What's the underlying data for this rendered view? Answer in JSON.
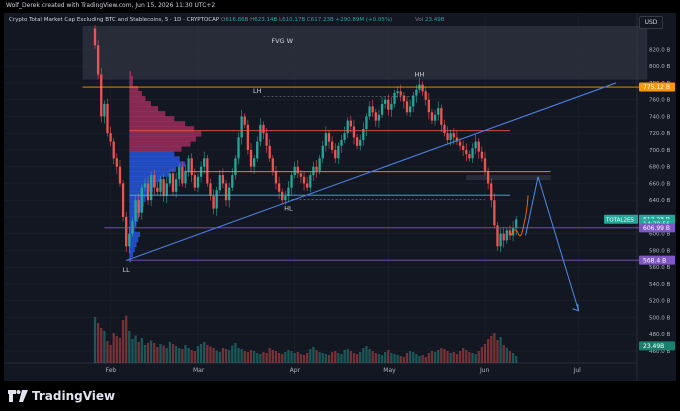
{
  "header": {
    "credit": "Wolf_Derek created with TradingView.com, Jun 15, 2026 11:30 UTC+2",
    "currency": "USD"
  },
  "legend": {
    "symbol": "Crypto Total Market Cap Excluding BTC and Stablecoins, 5 · 1D · CRYPTOCAP",
    "o_label": "O",
    "o": "616.86B",
    "h_label": "H",
    "h": "623.14B",
    "l_label": "L",
    "l": "610.17B",
    "c_label": "C",
    "c": "617.23B",
    "change": "+290.89M (+0.05%)",
    "vol_label": "Vol ",
    "vol": "23.49B"
  },
  "footer": {
    "brand": "TradingView"
  },
  "colors": {
    "up": "#26a69a",
    "down": "#ef5350",
    "background": "#131722",
    "grid": "#1e222d",
    "axis_text": "#b2b5be",
    "trendline": "#4c7dde",
    "orange": "#ff9800",
    "purple": "#7e57c2",
    "cyan": "#26c6da",
    "profile_blue": "#2962ff",
    "profile_pink": "#b8336a",
    "fvg_box": "#3a3e4a",
    "current_price": "#26a69a",
    "vol_label_bg": "#1b7f6e",
    "projection": "#4d8ce6",
    "curve": "#ff6d00"
  },
  "chart_data": {
    "type": "candlestick",
    "y_unit": "B",
    "ylim": [
      448,
      848
    ],
    "y_ticks": [
      460,
      480,
      500,
      520,
      540,
      560,
      580,
      600,
      620,
      640,
      660,
      680,
      700,
      720,
      740,
      760,
      780,
      800,
      820
    ],
    "x_ticks": [
      "Feb",
      "Mar",
      "Apr",
      "May",
      "Jun",
      "Jul"
    ],
    "price_labels": [
      {
        "text": "775.12 B",
        "value": 775.12,
        "color": "#ff9800"
      },
      {
        "text": "617.23 B",
        "value": 617.23,
        "color": "#26a69a",
        "prefix": "TOTAL2ES"
      },
      {
        "text": "14:29:56",
        "value": 612,
        "color": "#26a69a"
      },
      {
        "text": "606.99 B",
        "value": 606.99,
        "color": "#7e57c2"
      },
      {
        "text": "568.4 B",
        "value": 568.4,
        "color": "#7e57c2"
      },
      {
        "text": "23.49B",
        "value": 466,
        "color": "#1b7f6e"
      }
    ],
    "annotations": [
      {
        "text": "FVG W",
        "x": "Mar 28",
        "y": 828
      },
      {
        "text": "HH",
        "x": "May 11",
        "y": 788
      },
      {
        "text": "LH",
        "x": "Mar 20",
        "y": 768
      },
      {
        "text": "HL",
        "x": "Mar 30",
        "y": 628
      },
      {
        "text": "LL",
        "x": "Feb 06",
        "y": 554
      }
    ],
    "levels": [
      {
        "name": "orange-top",
        "value": 775.12,
        "from": "Jan 23",
        "to": "Jul 23",
        "color": "#ff9800"
      },
      {
        "name": "red-profile",
        "value": 723,
        "from": "Feb 07",
        "to": "Jun 09",
        "color": "#ef5350"
      },
      {
        "name": "orange-mid",
        "value": 674,
        "from": "Feb 25",
        "to": "Jun 22",
        "color": "#ff9800"
      },
      {
        "name": "cyan",
        "value": 646,
        "from": "Feb 07",
        "to": "Jun 09",
        "color": "#26c6da"
      },
      {
        "name": "purple-upper",
        "value": 606.99,
        "from": "Jan 30",
        "to": "Jul 23",
        "color": "#7e57c2"
      },
      {
        "name": "purple-lower",
        "value": 568.4,
        "from": "Feb 06",
        "to": "Jul 23",
        "color": "#7e57c2"
      }
    ],
    "dashed_levels": [
      {
        "value": 764,
        "from": "Mar 22",
        "to": "May 10"
      },
      {
        "value": 641,
        "from": "Mar 31",
        "to": "Jun 01"
      }
    ],
    "fvg_zones": [
      {
        "from": "Jan 23",
        "to": "Jul 23",
        "low": 784,
        "high": 848
      },
      {
        "from": "May 26",
        "to": "Jun 22",
        "low": 664,
        "high": 670
      }
    ],
    "trendline": {
      "from": [
        "Feb 06",
        568
      ],
      "to": [
        "Jul 13",
        780
      ]
    },
    "projection": [
      [
        "Jun 14",
        598
      ],
      [
        "Jun 18",
        668
      ],
      [
        "Jul 01",
        508
      ]
    ],
    "volume_profile": [
      [
        792,
        2
      ],
      [
        786,
        4
      ],
      [
        780,
        4
      ],
      [
        774,
        10
      ],
      [
        768,
        14
      ],
      [
        762,
        18
      ],
      [
        756,
        24
      ],
      [
        750,
        32
      ],
      [
        744,
        40
      ],
      [
        738,
        50
      ],
      [
        732,
        62
      ],
      [
        726,
        72
      ],
      [
        720,
        80
      ],
      [
        714,
        74
      ],
      [
        708,
        68
      ],
      [
        702,
        58
      ],
      [
        696,
        50
      ],
      [
        690,
        56
      ],
      [
        684,
        62
      ],
      [
        678,
        52
      ],
      [
        672,
        44
      ],
      [
        666,
        36
      ],
      [
        660,
        30
      ],
      [
        654,
        26
      ],
      [
        648,
        22
      ],
      [
        642,
        18
      ],
      [
        636,
        16
      ],
      [
        630,
        14
      ],
      [
        624,
        12
      ],
      [
        618,
        10
      ],
      [
        612,
        8
      ],
      [
        606,
        6
      ],
      [
        600,
        12
      ],
      [
        594,
        10
      ],
      [
        588,
        8
      ],
      [
        582,
        6
      ],
      [
        576,
        4
      ],
      [
        570,
        2
      ]
    ],
    "dates": [
      "Jan 27",
      "Jan 28",
      "Jan 29",
      "Jan 30",
      "Jan 31",
      "Feb 01",
      "Feb 02",
      "Feb 03",
      "Feb 04",
      "Feb 05",
      "Feb 06",
      "Feb 07",
      "Feb 08",
      "Feb 09",
      "Feb 10",
      "Feb 11",
      "Feb 12",
      "Feb 13",
      "Feb 14",
      "Feb 15",
      "Feb 16",
      "Feb 17",
      "Feb 18",
      "Feb 19",
      "Feb 20",
      "Feb 21",
      "Feb 22",
      "Feb 23",
      "Feb 24",
      "Feb 25",
      "Feb 26",
      "Feb 27",
      "Feb 28",
      "Mar 01",
      "Mar 02",
      "Mar 03",
      "Mar 04",
      "Mar 05",
      "Mar 06",
      "Mar 07",
      "Mar 08",
      "Mar 09",
      "Mar 10",
      "Mar 11",
      "Mar 12",
      "Mar 13",
      "Mar 14",
      "Mar 15",
      "Mar 16",
      "Mar 17",
      "Mar 18",
      "Mar 19",
      "Mar 20",
      "Mar 21",
      "Mar 22",
      "Mar 23",
      "Mar 24",
      "Mar 25",
      "Mar 26",
      "Mar 27",
      "Mar 28",
      "Mar 29",
      "Mar 30",
      "Mar 31",
      "Apr 01",
      "Apr 02",
      "Apr 03",
      "Apr 04",
      "Apr 05",
      "Apr 06",
      "Apr 07",
      "Apr 08",
      "Apr 09",
      "Apr 10",
      "Apr 11",
      "Apr 12",
      "Apr 13",
      "Apr 14",
      "Apr 15",
      "Apr 16",
      "Apr 17",
      "Apr 18",
      "Apr 19",
      "Apr 20",
      "Apr 21",
      "Apr 22",
      "Apr 23",
      "Apr 24",
      "Apr 25",
      "Apr 26",
      "Apr 27",
      "Apr 28",
      "Apr 29",
      "Apr 30",
      "May 01",
      "May 02",
      "May 03",
      "May 04",
      "May 05",
      "May 06",
      "May 07",
      "May 08",
      "May 09",
      "May 10",
      "May 11",
      "May 12",
      "May 13",
      "May 14",
      "May 15",
      "May 16",
      "May 17",
      "May 18",
      "May 19",
      "May 20",
      "May 21",
      "May 22",
      "May 23",
      "May 24",
      "May 25",
      "May 26",
      "May 27",
      "May 28",
      "May 29",
      "May 30",
      "May 31",
      "Jun 01",
      "Jun 02",
      "Jun 03",
      "Jun 04",
      "Jun 05",
      "Jun 06",
      "Jun 07",
      "Jun 08",
      "Jun 09",
      "Jun 10",
      "Jun 11",
      "Jun 12",
      "Jun 13",
      "Jun 14"
    ],
    "close": [
      825,
      790,
      740,
      755,
      720,
      710,
      690,
      680,
      660,
      620,
      585,
      600,
      615,
      640,
      625,
      655,
      660,
      640,
      670,
      655,
      650,
      665,
      645,
      660,
      672,
      650,
      665,
      680,
      660,
      675,
      690,
      670,
      655,
      668,
      680,
      690,
      660,
      645,
      630,
      652,
      670,
      660,
      640,
      655,
      670,
      690,
      715,
      740,
      730,
      700,
      680,
      690,
      710,
      730,
      720,
      705,
      690,
      675,
      660,
      650,
      640,
      645,
      655,
      670,
      680,
      672,
      668,
      660,
      655,
      670,
      680,
      675,
      690,
      705,
      720,
      710,
      700,
      690,
      705,
      712,
      720,
      735,
      728,
      715,
      705,
      712,
      725,
      740,
      752,
      745,
      735,
      742,
      755,
      760,
      748,
      755,
      768,
      770,
      765,
      758,
      745,
      752,
      765,
      772,
      778,
      770,
      760,
      745,
      735,
      742,
      750,
      730,
      720,
      712,
      720,
      715,
      710,
      705,
      700,
      695,
      690,
      702,
      710,
      698,
      690,
      675,
      660,
      640,
      610,
      585,
      600,
      592,
      604,
      598,
      607,
      617
    ],
    "volume": [
      92,
      80,
      70,
      64,
      44,
      36,
      60,
      54,
      50,
      86,
      95,
      64,
      48,
      55,
      42,
      50,
      36,
      40,
      45,
      40,
      32,
      38,
      35,
      30,
      42,
      38,
      34,
      30,
      28,
      36,
      30,
      26,
      24,
      34,
      38,
      42,
      36,
      33,
      30,
      25,
      22,
      30,
      28,
      26,
      35,
      40,
      30,
      28,
      24,
      22,
      26,
      24,
      20,
      18,
      22,
      20,
      30,
      26,
      24,
      20,
      18,
      22,
      26,
      24,
      20,
      22,
      18,
      16,
      20,
      28,
      32,
      26,
      22,
      20,
      18,
      16,
      22,
      24,
      20,
      18,
      26,
      28,
      24,
      20,
      18,
      22,
      30,
      34,
      28,
      24,
      20,
      18,
      16,
      22,
      26,
      20,
      18,
      16,
      14,
      12,
      20,
      24,
      22,
      18,
      14,
      16,
      12,
      20,
      24,
      22,
      26,
      30,
      28,
      24,
      20,
      22,
      18,
      24,
      30,
      26,
      22,
      20,
      18,
      24,
      32,
      38,
      48,
      54,
      60,
      46,
      52,
      36,
      30,
      24,
      20,
      14
    ]
  }
}
